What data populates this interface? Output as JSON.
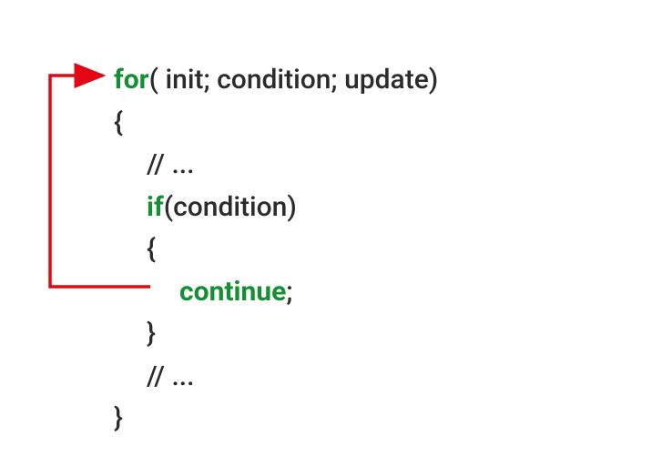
{
  "diagram": {
    "keyword_for": "for",
    "for_params": "( init; condition; update)",
    "lbrace1": "{",
    "comment1": "// ...",
    "keyword_if": "if",
    "if_params": "(condition)",
    "lbrace2": "{",
    "keyword_continue": "continue",
    "semicolon": ";",
    "rbrace2": "}",
    "comment2": "// ...",
    "rbrace1": "}",
    "arrow_color": "#e30613"
  }
}
